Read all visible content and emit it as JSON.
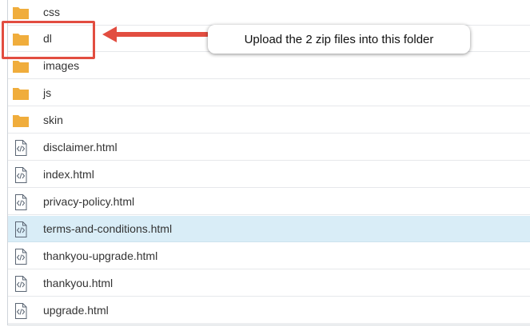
{
  "file_list": {
    "rows": [
      {
        "type": "folder",
        "name": "css"
      },
      {
        "type": "folder",
        "name": "dl"
      },
      {
        "type": "folder",
        "name": "images"
      },
      {
        "type": "folder",
        "name": "js"
      },
      {
        "type": "folder",
        "name": "skin"
      },
      {
        "type": "file",
        "name": "disclaimer.html"
      },
      {
        "type": "file",
        "name": "index.html"
      },
      {
        "type": "file",
        "name": "privacy-policy.html"
      },
      {
        "type": "file",
        "name": "terms-and-conditions.html"
      },
      {
        "type": "file",
        "name": "thankyou-upgrade.html"
      },
      {
        "type": "file",
        "name": "thankyou.html"
      },
      {
        "type": "file",
        "name": "upgrade.html"
      }
    ],
    "selected_item": "terms-and-conditions.html"
  },
  "annotation": {
    "callout_text": "Upload the 2 zip files into this folder",
    "target_folder": "dl",
    "color": "#e24d40"
  },
  "colors": {
    "folder": "#f0ad3c",
    "file_icon": "#5a6573",
    "selected_row": "#d9edf7"
  },
  "icons": {
    "folder": "folder-icon",
    "file": "html-file-icon",
    "arrow": "red-arrow-left"
  }
}
